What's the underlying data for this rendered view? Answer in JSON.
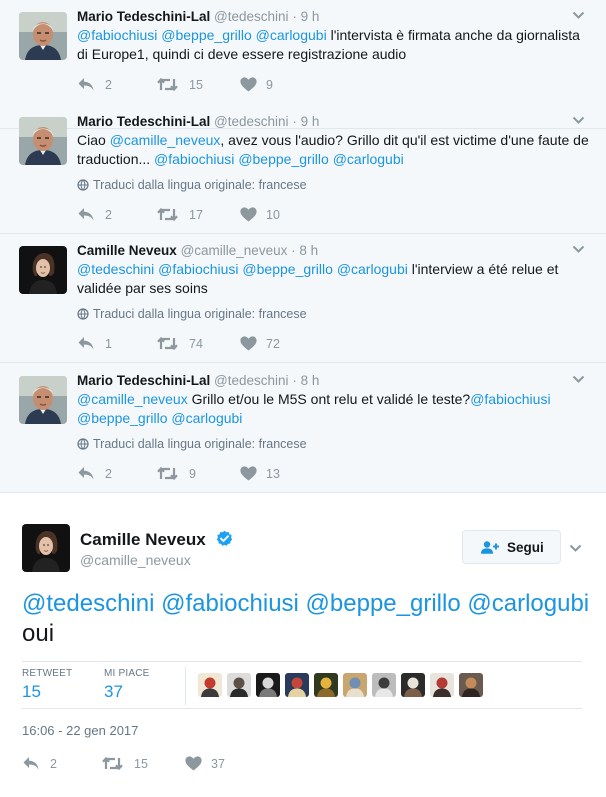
{
  "replies": [
    {
      "name": "Mario Tedeschini-Lal",
      "handle": "@tedeschini",
      "dot": "·",
      "time": "9 h",
      "segments": [
        {
          "text": "@fabiochiusi",
          "mention": true
        },
        {
          "text": " ",
          "mention": false
        },
        {
          "text": "@beppe_grillo",
          "mention": true
        },
        {
          "text": " ",
          "mention": false
        },
        {
          "text": "@carlogubi",
          "mention": true
        },
        {
          "text": " l'intervista è firmata anche da giornalista di Europe1, quindi ci deve essere registrazione audio",
          "mention": false
        }
      ],
      "translate": "",
      "replies_count": "2",
      "retweets_count": "15",
      "likes_count": "9"
    },
    {
      "name": "Mario Tedeschini-Lal",
      "handle": "@tedeschini",
      "dot": "·",
      "time": "9 h",
      "segments": [
        {
          "text": "Ciao ",
          "mention": false
        },
        {
          "text": "@camille_neveux",
          "mention": true
        },
        {
          "text": ", avez vous l'audio? Grillo dit qu'il est victime d'une faute de traduction... ",
          "mention": false
        },
        {
          "text": "@fabiochiusi",
          "mention": true
        },
        {
          "text": " ",
          "mention": false
        },
        {
          "text": "@beppe_grillo",
          "mention": true
        },
        {
          "text": " ",
          "mention": false
        },
        {
          "text": "@carlogubi",
          "mention": true
        }
      ],
      "translate": "Traduci dalla lingua originale: francese",
      "replies_count": "2",
      "retweets_count": "17",
      "likes_count": "10"
    },
    {
      "name": "Camille Neveux",
      "handle": "@camille_neveux",
      "dot": "·",
      "time": "8 h",
      "segments": [
        {
          "text": "@tedeschini",
          "mention": true
        },
        {
          "text": " ",
          "mention": false
        },
        {
          "text": "@fabiochiusi",
          "mention": true
        },
        {
          "text": " ",
          "mention": false
        },
        {
          "text": "@beppe_grillo",
          "mention": true
        },
        {
          "text": " ",
          "mention": false
        },
        {
          "text": "@carlogubi",
          "mention": true
        },
        {
          "text": " l'interview a été relue et validée par ses soins",
          "mention": false
        }
      ],
      "translate": "Traduci dalla lingua originale: francese",
      "replies_count": "1",
      "retweets_count": "74",
      "likes_count": "72"
    },
    {
      "name": "Mario Tedeschini-Lal",
      "handle": "@tedeschini",
      "dot": "·",
      "time": "8 h",
      "segments": [
        {
          "text": "@camille_neveux",
          "mention": true
        },
        {
          "text": " Grillo et/ou le M5S ont relu  et validé le teste?",
          "mention": false
        },
        {
          "text": "@fabiochiusi",
          "mention": true
        },
        {
          "text": " ",
          "mention": false
        },
        {
          "text": "@beppe_grillo",
          "mention": true
        },
        {
          "text": " ",
          "mention": false
        },
        {
          "text": "@carlogubi",
          "mention": true
        }
      ],
      "translate": "Traduci dalla lingua originale: francese",
      "replies_count": "2",
      "retweets_count": "9",
      "likes_count": "13"
    }
  ],
  "main": {
    "name": "Camille Neveux",
    "handle": "@camille_neveux",
    "follow_label": "Segui",
    "segments": [
      {
        "text": "@tedeschini",
        "mention": true
      },
      {
        "text": " ",
        "mention": false
      },
      {
        "text": "@fabiochiusi",
        "mention": true
      },
      {
        "text": " ",
        "mention": false
      },
      {
        "text": "@beppe_grillo",
        "mention": true
      },
      {
        "text": " ",
        "mention": false
      },
      {
        "text": "@carlogubi",
        "mention": true
      },
      {
        "text": " oui",
        "mention": false
      }
    ],
    "retweet_label": "RETWEET",
    "retweet_count": "15",
    "likes_label": "MI PIACE",
    "likes_count": "37",
    "timestamp": "16:06 - 22 gen 2017",
    "replies_count": "2",
    "retweets_count": "15",
    "likes_count_bar": "37"
  },
  "colors": {
    "accent": "#1b95e0",
    "muted": "#8c979e",
    "replies_background": "#f5f8fa",
    "verified": "#1da1f2"
  },
  "icons": [
    "chevron-down-icon",
    "reply-icon",
    "retweet-icon",
    "heart-icon",
    "globe-icon",
    "verified-badge-icon",
    "add-user-icon"
  ]
}
